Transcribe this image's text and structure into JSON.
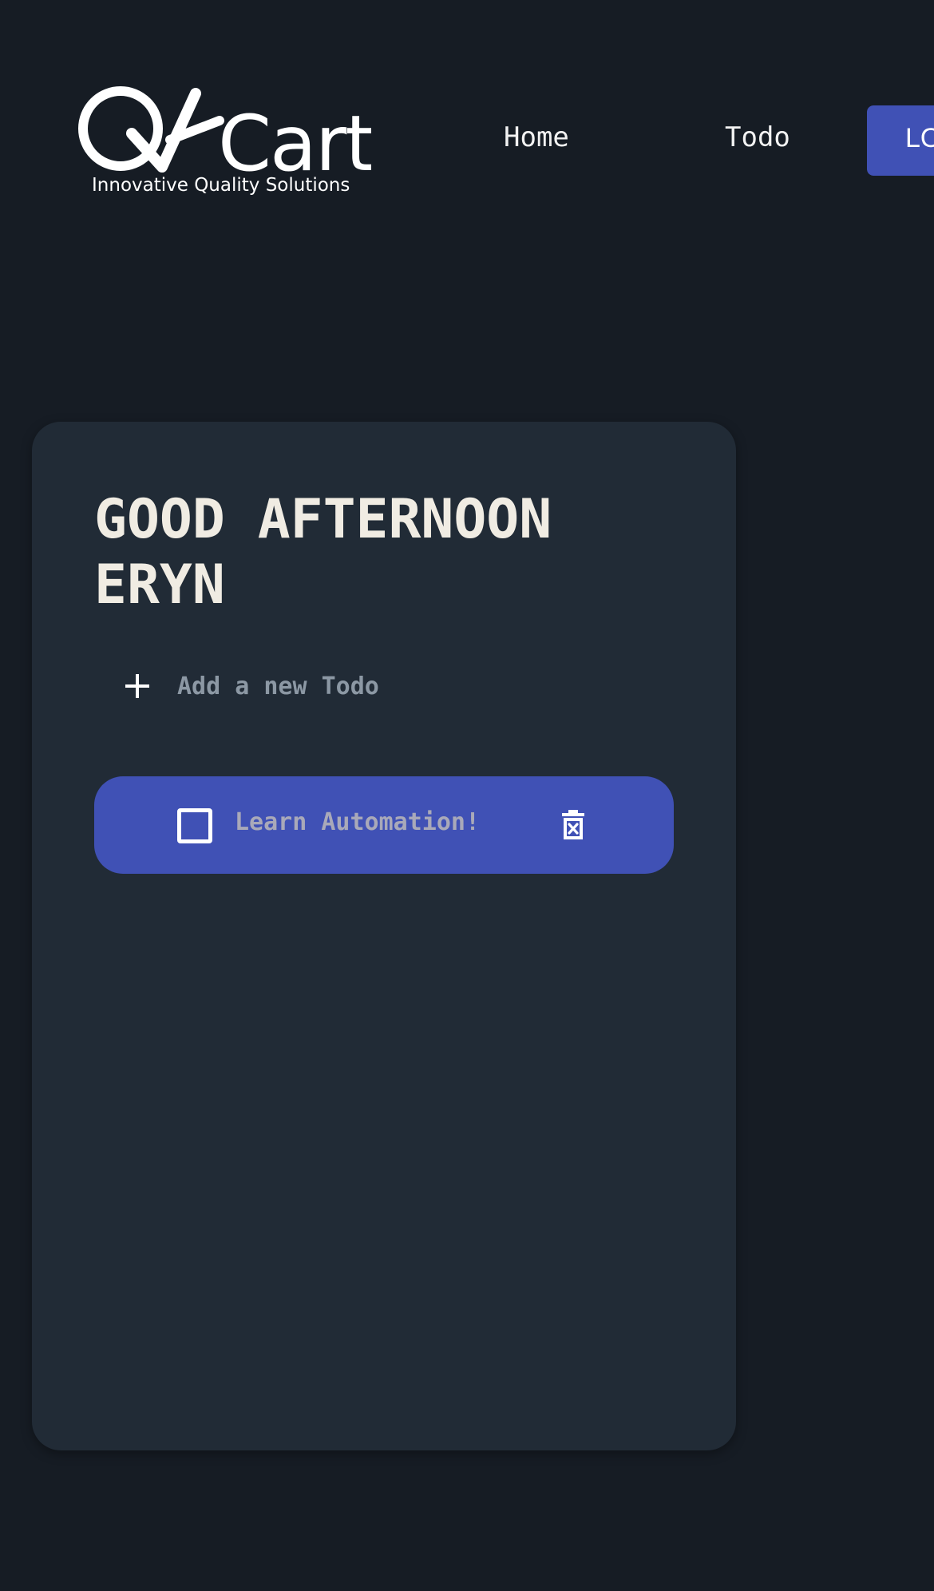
{
  "header": {
    "logo": {
      "wordmark": "QACart",
      "tagline": "Innovative Quality Solutions"
    },
    "nav": {
      "home_label": "Home",
      "todo_label": "Todo",
      "logout_label": "LOGOUT"
    }
  },
  "main": {
    "greeting": "GOOD AFTERNOON ERYN",
    "new_todo": {
      "placeholder": "Add a new Todo",
      "value": ""
    },
    "todos": [
      {
        "text": "Learn Automation!",
        "completed": false
      }
    ]
  },
  "icons": {
    "add": "plus-icon",
    "checkbox": "checkbox-outline-icon",
    "delete": "trash-x-icon"
  },
  "colors": {
    "background": "#161c24",
    "card": "#212b36",
    "accent": "#4051b5",
    "heading": "#f0ece3",
    "muted_text": "#8c98a4",
    "todo_text": "#a9a9b9"
  }
}
